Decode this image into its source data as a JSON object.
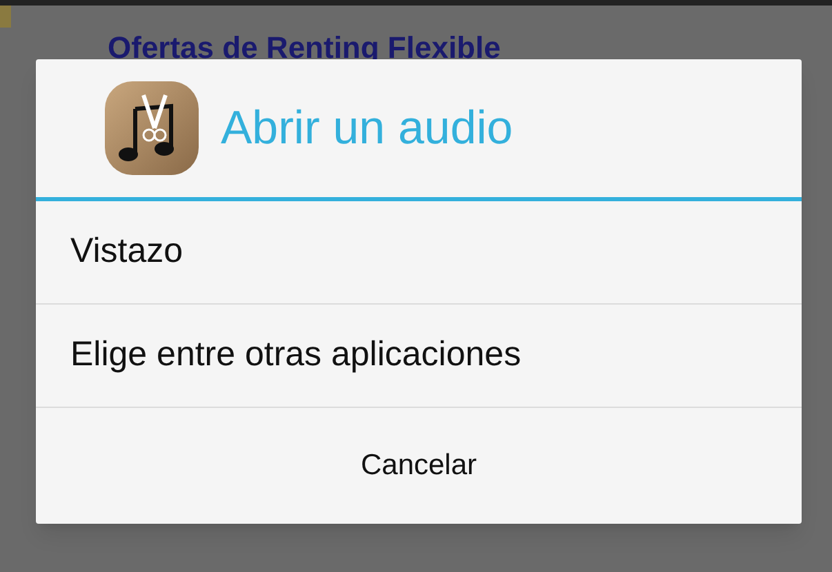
{
  "background": {
    "headline": "Ofertas de Renting Flexible"
  },
  "dialog": {
    "title": "Abrir un audio",
    "options": [
      {
        "label": "Vistazo"
      },
      {
        "label": "Elige entre otras aplicaciones"
      }
    ],
    "cancel_button": "Cancelar"
  }
}
